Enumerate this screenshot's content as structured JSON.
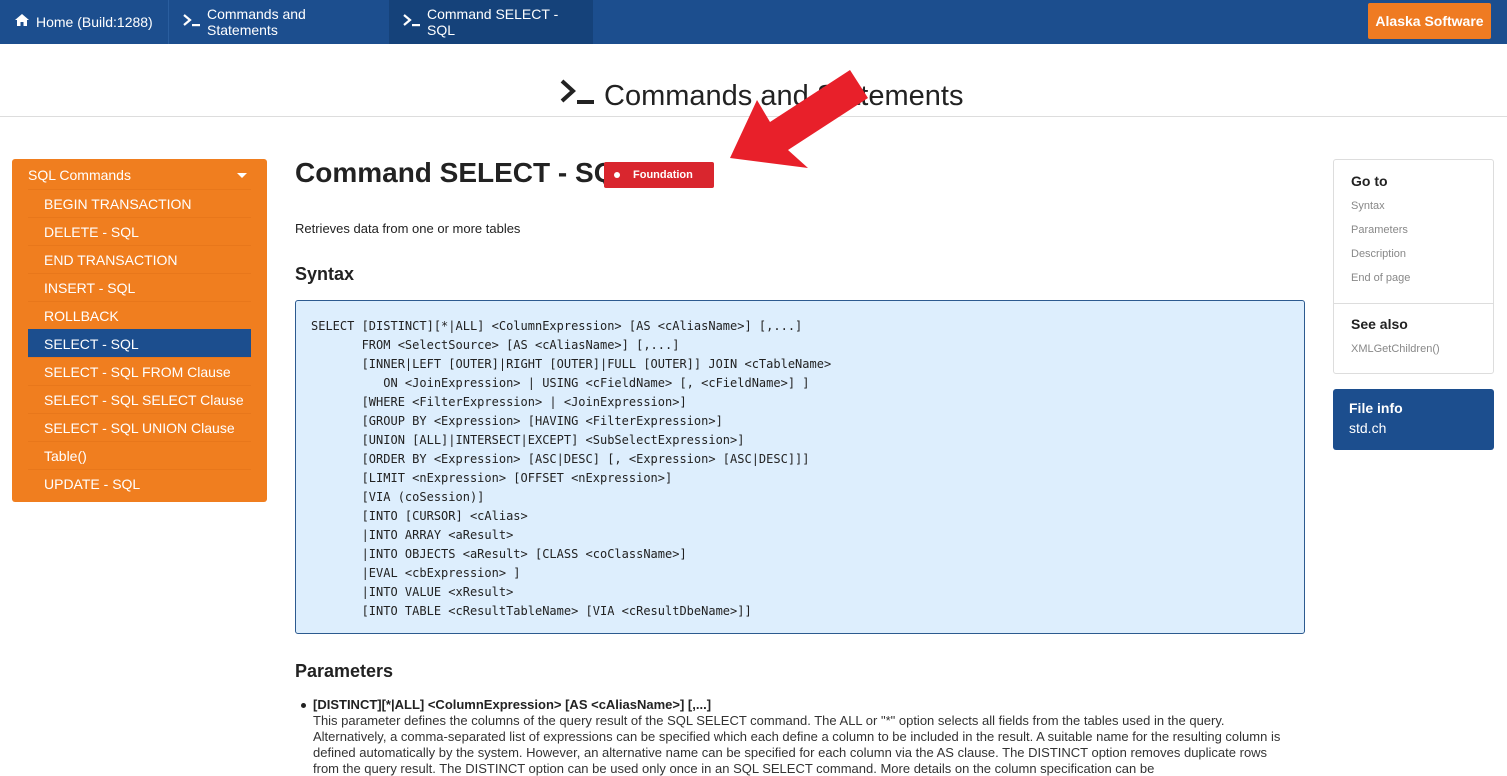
{
  "topnav": {
    "crumbs": [
      {
        "icon": "home-icon",
        "label": "Home (Build:1288)"
      },
      {
        "icon": "terminal-icon",
        "label": "Commands and Statements"
      },
      {
        "icon": "terminal-icon",
        "label": "Command SELECT - SQL"
      }
    ],
    "brand_button": "Alaska Software",
    "bg_color": "#1c4e8e",
    "accent_color": "#ef7b22"
  },
  "page": {
    "title_icon": ">_",
    "title": "Commands and Statements"
  },
  "sidebar": {
    "heading": "SQL Commands",
    "items": [
      {
        "label": "BEGIN TRANSACTION"
      },
      {
        "label": "DELETE - SQL"
      },
      {
        "label": "END TRANSACTION"
      },
      {
        "label": "INSERT - SQL"
      },
      {
        "label": "ROLLBACK"
      },
      {
        "label": "SELECT - SQL",
        "active": true
      },
      {
        "label": "SELECT - SQL FROM Clause"
      },
      {
        "label": "SELECT - SQL SELECT Clause"
      },
      {
        "label": "SELECT - SQL UNION Clause"
      },
      {
        "label": "Table()"
      },
      {
        "label": "UPDATE - SQL"
      }
    ]
  },
  "main": {
    "title": "Command SELECT - SQL",
    "badge": "Foundation",
    "description": "Retrieves data from one or more tables",
    "syntax_heading": "Syntax",
    "syntax_code": "SELECT [DISTINCT][*|ALL] <ColumnExpression> [AS <cAliasName>] [,...]\n       FROM <SelectSource> [AS <cAliasName>] [,...]\n       [INNER|LEFT [OUTER]|RIGHT [OUTER]|FULL [OUTER]] JOIN <cTableName>\n          ON <JoinExpression> | USING <cFieldName> [, <cFieldName>] ]\n       [WHERE <FilterExpression> | <JoinExpression>]\n       [GROUP BY <Expression> [HAVING <FilterExpression>]\n       [UNION [ALL]|INTERSECT|EXCEPT] <SubSelectExpression>]\n       [ORDER BY <Expression> [ASC|DESC] [, <Expression> [ASC|DESC]]]\n       [LIMIT <nExpression> [OFFSET <nExpression>]\n       [VIA (coSession)]\n       [INTO [CURSOR] <cAlias>\n       |INTO ARRAY <aResult>\n       |INTO OBJECTS <aResult> [CLASS <coClassName>]\n       |EVAL <cbExpression> ]\n       |INTO VALUE <xResult>\n       [INTO TABLE <cResultTableName> [VIA <cResultDbeName>]]",
    "parameters_heading": "Parameters",
    "parameters": [
      {
        "title": "[DISTINCT][*|ALL] <ColumnExpression> [AS <cAliasName>] [,...]",
        "text": "This parameter defines the columns of the query result of the SQL SELECT command. The ALL or \"*\" option selects all fields from the tables used in the query. Alternatively, a comma-separated list of expressions can be specified which each define a column to be included in the result. A suitable name for the resulting column is defined automatically by the system. However, an alternative name can be specified for each column via the AS clause. The DISTINCT option removes duplicate rows from the query result. The DISTINCT option can be used only once in an SQL SELECT command. More details on the column specification can be"
      }
    ]
  },
  "goto": {
    "heading": "Go to",
    "links": [
      "Syntax",
      "Parameters",
      "Description",
      "End of page"
    ],
    "see_also_heading": "See also",
    "see_also": [
      "XMLGetChildren()"
    ]
  },
  "fileinfo": {
    "heading": "File info",
    "value": "std.ch"
  }
}
